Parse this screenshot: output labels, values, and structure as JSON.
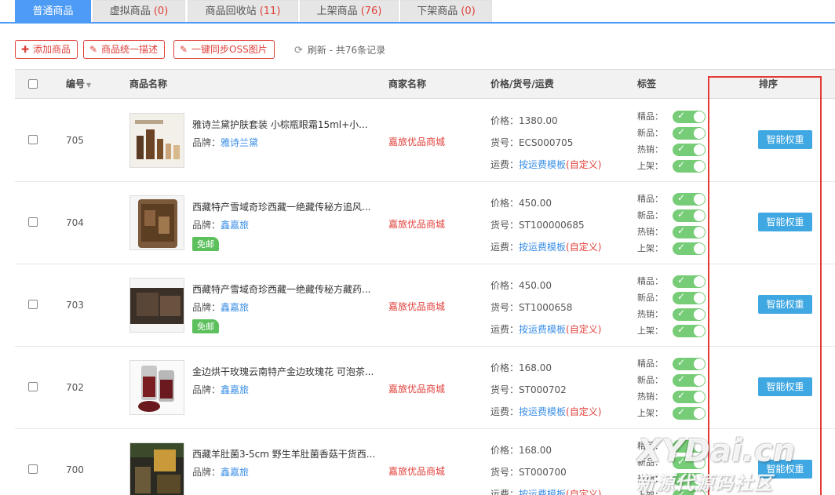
{
  "tabs": [
    {
      "label": "普通商品",
      "count": ""
    },
    {
      "label": "虚拟商品 ",
      "count": "(0)"
    },
    {
      "label": "商品回收站 ",
      "count": "(11)"
    },
    {
      "label": "上架商品 ",
      "count": "(76)"
    },
    {
      "label": "下架商品 ",
      "count": "(0)"
    }
  ],
  "toolbar": {
    "add_label": "添加商品",
    "describe_label": "商品统一描述",
    "sync_label": "一键同步OSS图片",
    "refresh_label": "刷新 - 共76条记录"
  },
  "columns": {
    "id": "编号",
    "name": "商品名称",
    "merchant": "商家名称",
    "price": "价格/货号/运费",
    "tags": "标签",
    "sort": "排序"
  },
  "labels": {
    "brand": "品牌：",
    "price": "价格：",
    "sku": "货号：",
    "shipping": "运费：",
    "tag_featured": "精品：",
    "tag_new": "新品：",
    "tag_hot": "热销：",
    "tag_listed": "上架：",
    "weight_button": "智能权重"
  },
  "rows": [
    {
      "id": "705",
      "name": "雅诗兰黛护肤套装 小棕瓶眼霜15ml+小...",
      "brand": "雅诗兰黛",
      "free_shipping": "",
      "merchant": "嘉旅优品商城",
      "price": "1380.00",
      "sku": "ECS000705",
      "shipping_link": "按运费模板",
      "shipping_custom": "(自定义)"
    },
    {
      "id": "704",
      "name": "西藏特产雪域奇珍西藏一绝藏传秘方追风...",
      "brand": "鑫嘉旅",
      "free_shipping": "免邮",
      "merchant": "嘉旅优品商城",
      "price": "450.00",
      "sku": "ST100000685",
      "shipping_link": "按运费模板",
      "shipping_custom": "(自定义)"
    },
    {
      "id": "703",
      "name": "西藏特产雪域奇珍西藏一绝藏传秘方藏药...",
      "brand": "鑫嘉旅",
      "free_shipping": "免邮",
      "merchant": "嘉旅优品商城",
      "price": "450.00",
      "sku": "ST1000658",
      "shipping_link": "按运费模板",
      "shipping_custom": "(自定义)"
    },
    {
      "id": "702",
      "name": "金边烘干玫瑰云南特产金边玫瑰花 可泡茶...",
      "brand": "鑫嘉旅",
      "free_shipping": "",
      "merchant": "嘉旅优品商城",
      "price": "168.00",
      "sku": "ST000702",
      "shipping_link": "按运费模板",
      "shipping_custom": "(自定义)"
    },
    {
      "id": "700",
      "name": "西藏羊肚菌3-5cm 野生羊肚菌香菇干货西...",
      "brand": "鑫嘉旅",
      "free_shipping": "",
      "merchant": "嘉旅优品商城",
      "price": "168.00",
      "sku": "ST000700",
      "shipping_link": "按运费模板",
      "shipping_custom": "(自定义)"
    }
  ],
  "watermark": {
    "main": "XYDai.cn",
    "sub": "新源代源码社区"
  },
  "colors": {
    "accent": "#4d9bf5",
    "danger": "#e0413b",
    "link": "#3a8ee6",
    "toggle_on": "#77cc77",
    "weight_button": "#3fa7e1",
    "highlight": "#e53935"
  }
}
